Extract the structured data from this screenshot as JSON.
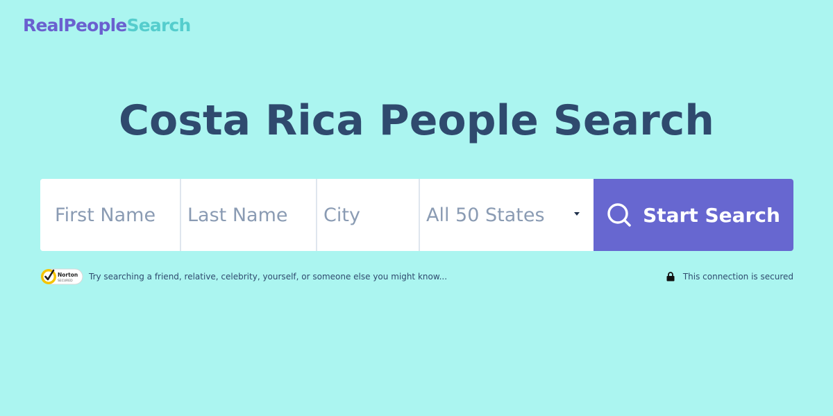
{
  "logo": {
    "part1": "RealPeople",
    "part2": "Search"
  },
  "title": "Costa Rica People Search",
  "search": {
    "first_name_placeholder": "First Name",
    "last_name_placeholder": "Last Name",
    "city_placeholder": "City",
    "state_selected": "All 50 States",
    "submit_label": "Start Search"
  },
  "badge": {
    "line1": "Norton",
    "line2": "SECURED"
  },
  "hint_text": "Try searching a friend, relative, celebrity, yourself, or someone else you might know...",
  "secure_text": "This connection is secured",
  "colors": {
    "background": "#abf5f0",
    "brand_purple": "#6a60cf",
    "brand_teal": "#55cdcd",
    "title_navy": "#2f4a6e",
    "button": "#6767d0",
    "norton_yellow": "#f5c400"
  },
  "icons": [
    "search-icon",
    "chevron-down-icon",
    "norton-check-icon",
    "lock-icon"
  ]
}
